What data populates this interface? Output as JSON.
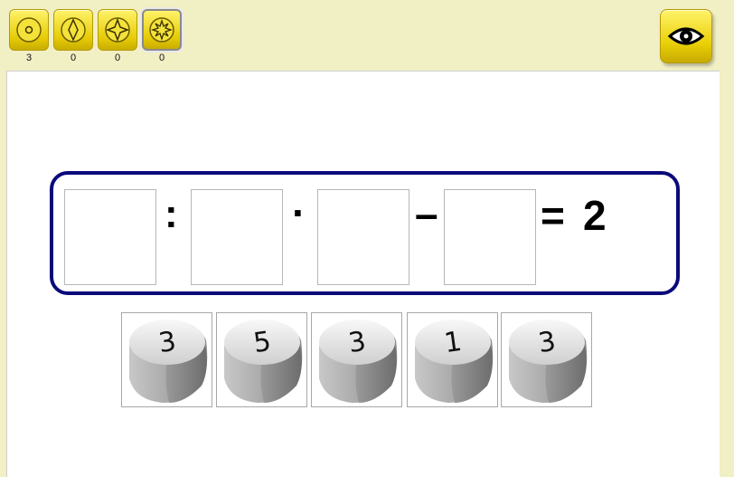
{
  "toolbar": {
    "levels": [
      {
        "icon": "dot-coin-icon",
        "count": "3"
      },
      {
        "icon": "diamond-coin-icon",
        "count": "0"
      },
      {
        "icon": "star4-coin-icon",
        "count": "0"
      },
      {
        "icon": "star8-coin-icon",
        "count": "0",
        "selected": true
      }
    ],
    "eye_icon": "eye-icon",
    "accent": "#e6cc06"
  },
  "equation": {
    "operator1": ":",
    "operator2": "·",
    "operator3": "–",
    "equals": "=",
    "result": "2",
    "border_color": "#0a0a7a"
  },
  "dice": [
    "3",
    "5",
    "3",
    "1",
    "3"
  ]
}
